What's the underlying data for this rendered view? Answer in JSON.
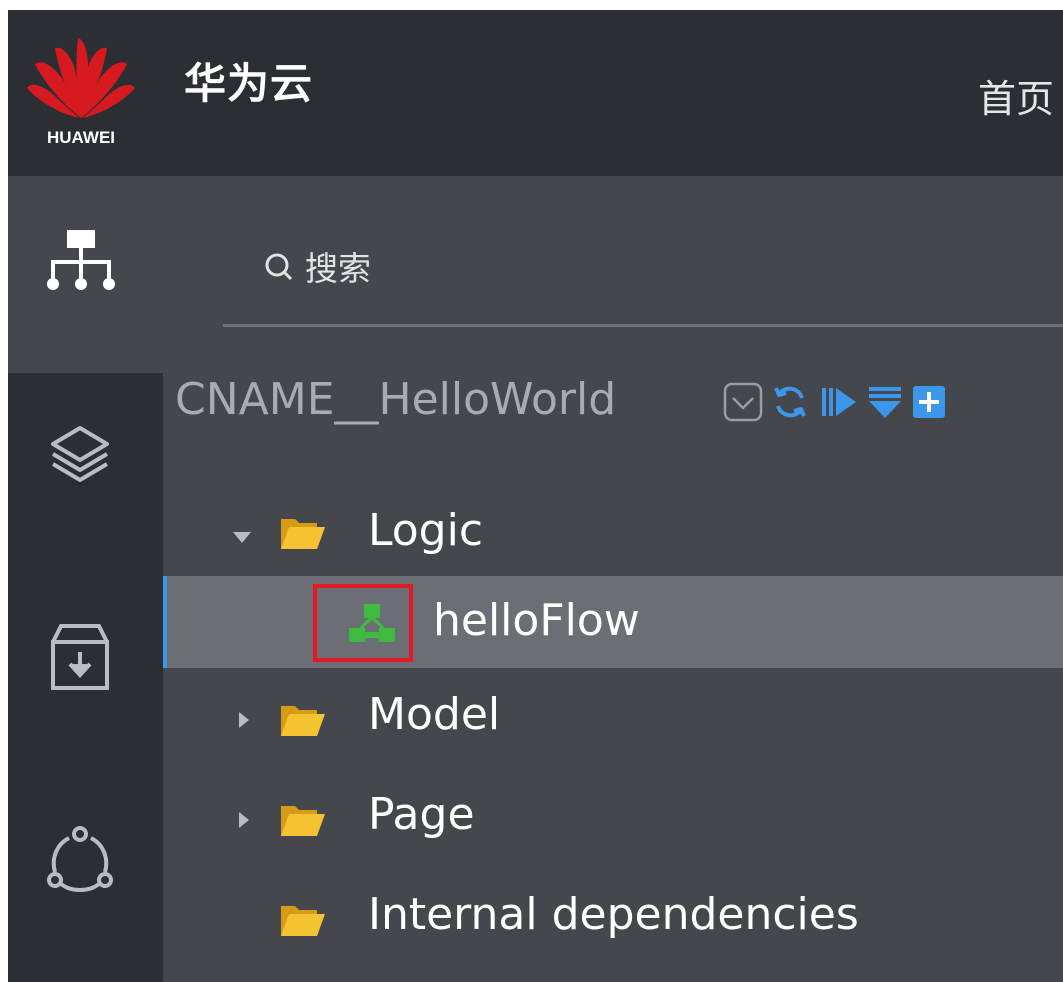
{
  "header": {
    "logo_text": "HUAWEI",
    "brand": "华为云",
    "nav_home": "首页"
  },
  "search": {
    "placeholder": "搜索"
  },
  "project": {
    "name": "CNAME__HelloWorld",
    "toolbar_icons": [
      "chevron-down-icon",
      "refresh-icon",
      "run-icon",
      "collapse-icon",
      "add-icon"
    ]
  },
  "tree": {
    "items": [
      {
        "label": "Logic",
        "state": "expanded",
        "icon": "folder-icon"
      },
      {
        "label": "helloFlow",
        "state": "selected",
        "icon": "flow-icon"
      },
      {
        "label": "Model",
        "state": "collapsed",
        "icon": "folder-icon"
      },
      {
        "label": "Page",
        "state": "collapsed",
        "icon": "folder-icon"
      },
      {
        "label": "Internal dependencies",
        "state": "leaf",
        "icon": "folder-icon"
      }
    ]
  },
  "rail_icons": [
    "sitemap-icon",
    "layers-icon",
    "archive-download-icon",
    "connections-icon"
  ],
  "colors": {
    "topbar": "#2b2e33",
    "panel": "#44474c",
    "selected_row": "#6b6f75",
    "selection_bar": "#3c97ea",
    "accent_blue": "#3c97ea",
    "folder": "#f0b928",
    "flow_icon": "#3fbb3f",
    "highlight_box": "#e21a22",
    "huawei_red": "#d71920"
  }
}
